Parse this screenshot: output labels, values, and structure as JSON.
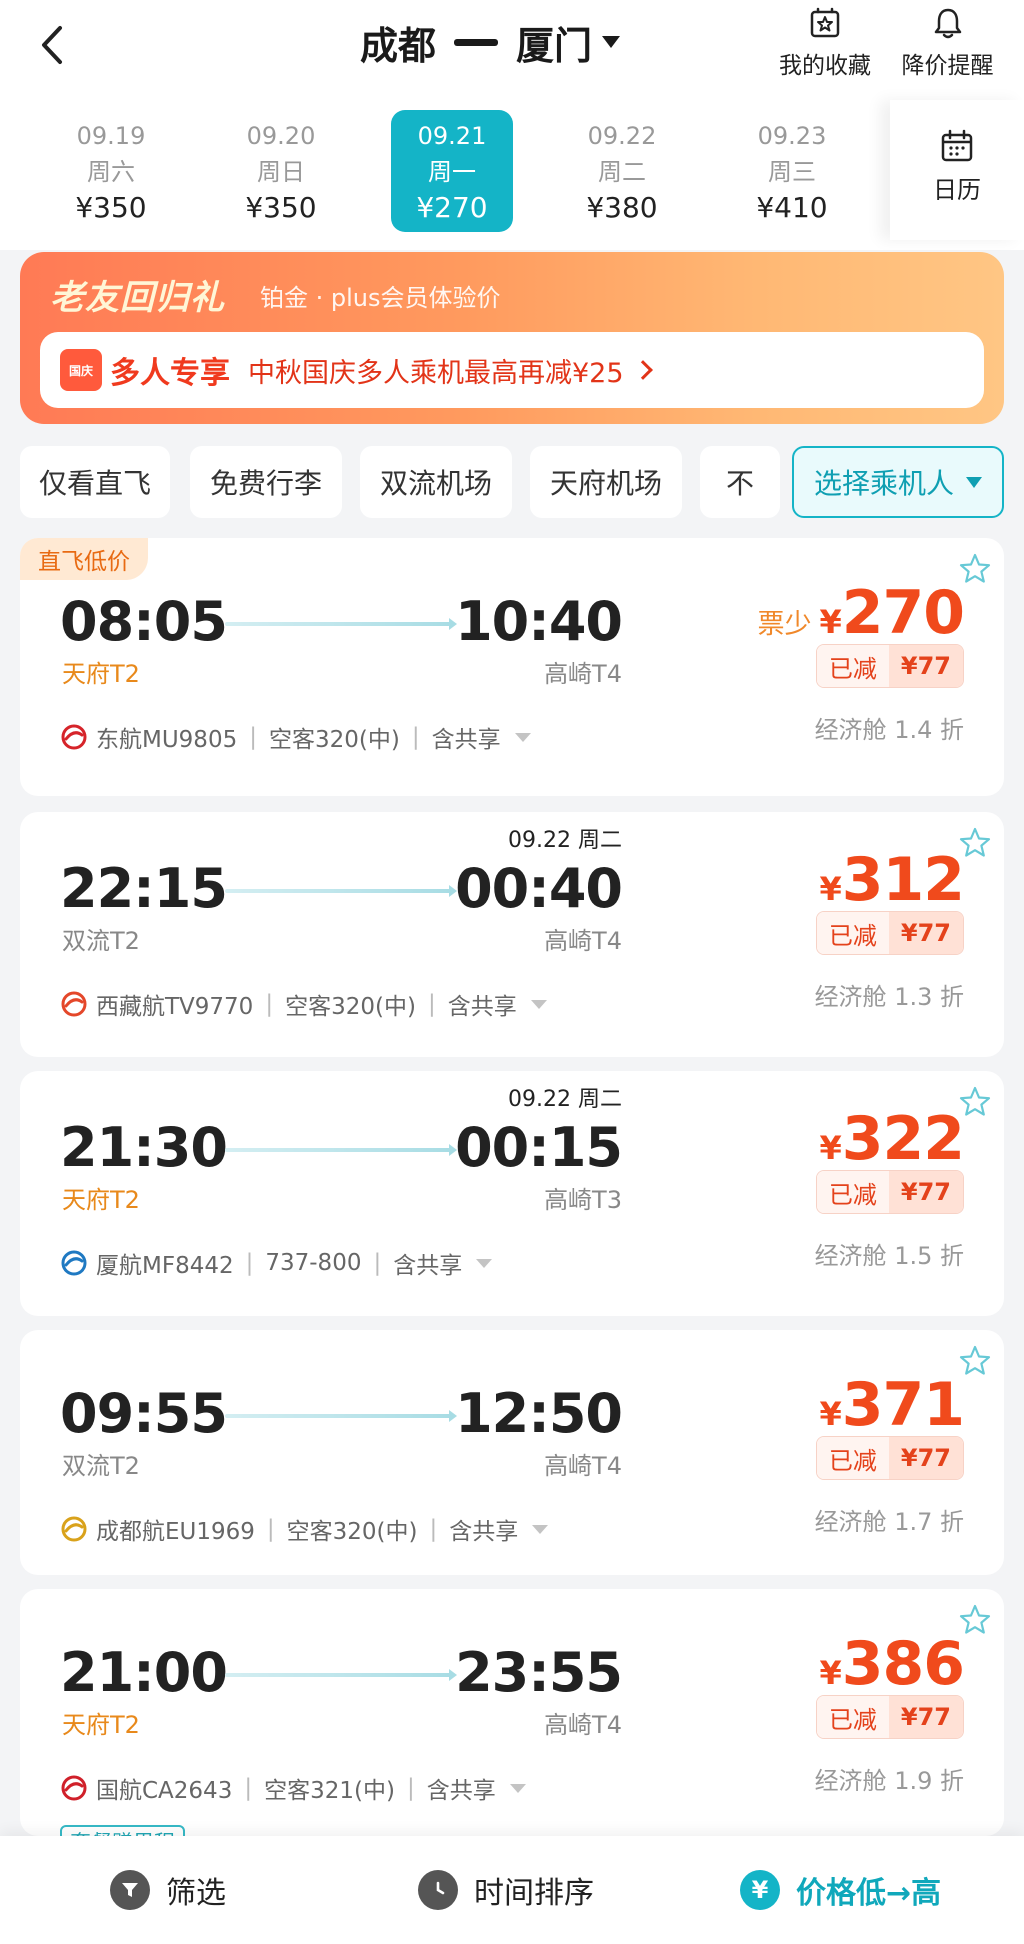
{
  "header": {
    "from": "成都",
    "to": "厦门",
    "favorites_label": "我的收藏",
    "price_alert_label": "降价提醒"
  },
  "dates": [
    {
      "date": "09.19",
      "weekday": "周六",
      "price": "¥350"
    },
    {
      "date": "09.20",
      "weekday": "周日",
      "price": "¥350"
    },
    {
      "date": "09.21",
      "weekday": "周一",
      "price": "¥270",
      "active": true
    },
    {
      "date": "09.22",
      "weekday": "周二",
      "price": "¥380"
    },
    {
      "date": "09.23",
      "weekday": "周三",
      "price": "¥410"
    }
  ],
  "calendar_label": "日历",
  "banner": {
    "title": "老友回归礼",
    "subtitle": "铂金 · plus会员体验价",
    "tag_icon_text": "国庆",
    "strong": "多人专享",
    "desc": "中秋国庆多人乘机最高再减¥25"
  },
  "filters": [
    "仅看直飞",
    "免费行李",
    "双流机场",
    "天府机场",
    "不"
  ],
  "select_passenger": "选择乘机人",
  "flights": [
    {
      "badge": "直飞低价",
      "dep_time": "08:05",
      "dep_term": "天府T2",
      "dep_orange": true,
      "arr_time": "10:40",
      "arr_term": "高崎T4",
      "next_day": "",
      "airline": "东航MU9805",
      "aircraft": "空客320(中)",
      "share": "含共享",
      "few": "票少",
      "price": "270",
      "cut_label": "已减",
      "cut": "¥77",
      "cabin": "经济舱 1.4 折",
      "logo_color": "#d6242a"
    },
    {
      "badge": "",
      "dep_time": "22:15",
      "dep_term": "双流T2",
      "dep_orange": false,
      "arr_time": "00:40",
      "arr_term": "高崎T4",
      "next_day": "09.22 周二",
      "airline": "西藏航TV9770",
      "aircraft": "空客320(中)",
      "share": "含共享",
      "few": "",
      "price": "312",
      "cut_label": "已减",
      "cut": "¥77",
      "cabin": "经济舱 1.3 折",
      "logo_color": "#e4472a"
    },
    {
      "badge": "",
      "dep_time": "21:30",
      "dep_term": "天府T2",
      "dep_orange": true,
      "arr_time": "00:15",
      "arr_term": "高崎T3",
      "next_day": "09.22 周二",
      "airline": "厦航MF8442",
      "aircraft": "737-800",
      "share": "含共享",
      "few": "",
      "price": "322",
      "cut_label": "已减",
      "cut": "¥77",
      "cabin": "经济舱 1.5 折",
      "logo_color": "#1f79c2"
    },
    {
      "badge": "",
      "dep_time": "09:55",
      "dep_term": "双流T2",
      "dep_orange": false,
      "arr_time": "12:50",
      "arr_term": "高崎T4",
      "next_day": "",
      "airline": "成都航EU1969",
      "aircraft": "空客320(中)",
      "share": "含共享",
      "few": "",
      "price": "371",
      "cut_label": "已减",
      "cut": "¥77",
      "cabin": "经济舱 1.7 折",
      "logo_color": "#d9a21b"
    },
    {
      "badge": "",
      "dep_time": "21:00",
      "dep_term": "天府T2",
      "dep_orange": true,
      "arr_time": "23:55",
      "arr_term": "高崎T4",
      "next_day": "",
      "airline": "国航CA2643",
      "aircraft": "空客321(中)",
      "share": "含共享",
      "few": "",
      "price": "386",
      "cut_label": "已减",
      "cut": "¥77",
      "cabin": "经济舱 1.9 折",
      "logo_color": "#d0202a",
      "extra_tag": "套餐赠里程"
    }
  ],
  "bottom": {
    "filter_label": "筛选",
    "time_sort_label": "时间排序",
    "price_sort_label": "价格低→高"
  },
  "colors": {
    "accent": "#14b4c7",
    "price": "#f04a1c",
    "orange": "#e8891b"
  }
}
